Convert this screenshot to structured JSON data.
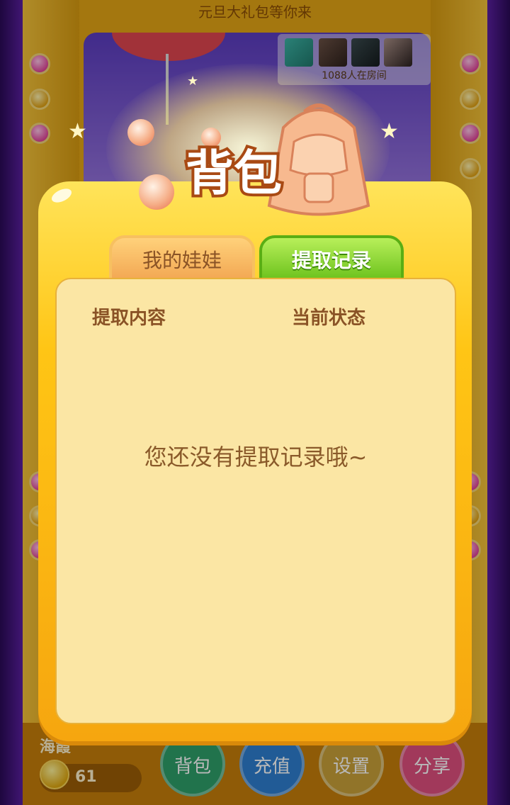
{
  "game": {
    "banner": "元旦大礼包等你来",
    "room_count_text": "1088人在房间",
    "user": {
      "name": "海霞",
      "coins": "61"
    },
    "bottom_buttons": [
      {
        "label": "背包",
        "color": "#2ea06a"
      },
      {
        "label": "充值",
        "color": "#2f7fd0"
      },
      {
        "label": "设置",
        "color": "#c9a13a"
      },
      {
        "label": "分享",
        "color": "#e0507f"
      }
    ]
  },
  "modal": {
    "title": "背包",
    "tabs": [
      {
        "label": "我的娃娃",
        "active": false
      },
      {
        "label": "提取记录",
        "active": true
      }
    ],
    "columns": [
      "提取内容",
      "当前状态"
    ],
    "empty_message": "您还没有提取记录哦~"
  },
  "colors": {
    "panel_yellow": "#ffc515",
    "content_bg": "#fbe6a4",
    "active_tab_green": "#6fc41f",
    "text_brown": "#8a5326"
  }
}
